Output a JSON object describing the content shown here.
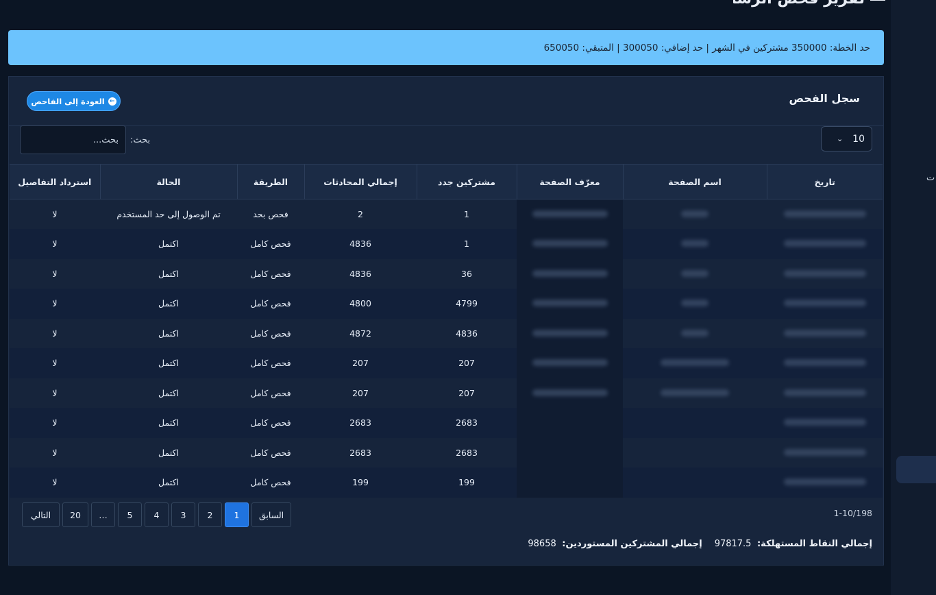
{
  "page": {
    "heading": "تقرير فحص الرسائل",
    "sidebar_stub": "ت"
  },
  "banner": {
    "text": "حد الخطة: 350000 مشتركين في الشهر | حد إضافي: 300050 | المتبقي: 650050"
  },
  "card": {
    "title": "سجل الفحص",
    "back_label": "العودة إلى الفاحص",
    "length_value": "10",
    "search_label": "بحث:",
    "search_placeholder": "بحث..."
  },
  "table": {
    "headers": [
      "تاريخ",
      "اسم الصفحة",
      "معرّف الصفحة",
      "مشتركين جدد",
      "إجمالي المحادثات",
      "الطريقة",
      "الحالة",
      "استرداد التفاصيل"
    ],
    "rows": [
      {
        "subscribers": "1",
        "conversations": "2",
        "method": "فحص بحد",
        "status": "تم الوصول إلى حد المستخدم",
        "refund": "لا"
      },
      {
        "subscribers": "1",
        "conversations": "4836",
        "method": "فحص كامل",
        "status": "اكتمل",
        "refund": "لا"
      },
      {
        "subscribers": "36",
        "conversations": "4836",
        "method": "فحص كامل",
        "status": "اكتمل",
        "refund": "لا"
      },
      {
        "subscribers": "4799",
        "conversations": "4800",
        "method": "فحص كامل",
        "status": "اكتمل",
        "refund": "لا"
      },
      {
        "subscribers": "4836",
        "conversations": "4872",
        "method": "فحص كامل",
        "status": "اكتمل",
        "refund": "لا"
      },
      {
        "subscribers": "207",
        "conversations": "207",
        "method": "فحص كامل",
        "status": "اكتمل",
        "refund": "لا"
      },
      {
        "subscribers": "207",
        "conversations": "207",
        "method": "فحص كامل",
        "status": "اكتمل",
        "refund": "لا"
      },
      {
        "subscribers": "2683",
        "conversations": "2683",
        "method": "فحص كامل",
        "status": "اكتمل",
        "refund": "لا"
      },
      {
        "subscribers": "2683",
        "conversations": "2683",
        "method": "فحص كامل",
        "status": "اكتمل",
        "refund": "لا"
      },
      {
        "subscribers": "199",
        "conversations": "199",
        "method": "فحص كامل",
        "status": "اكتمل",
        "refund": "لا"
      }
    ]
  },
  "footer": {
    "info": "1-10/198",
    "pagination": {
      "prev": "السابق",
      "pages": [
        "1",
        "2",
        "3",
        "4",
        "5",
        "…",
        "20"
      ],
      "next": "التالي",
      "active_page": "1"
    },
    "total_points_label": "إجمالي النقاط المستهلكة:",
    "total_points_value": "97817.5",
    "total_subscribers_label": "إجمالي المشتركين المستوردين:",
    "total_subscribers_value": "98658"
  },
  "colors": {
    "banner": "#6cc3fd",
    "accent": "#1e88e5",
    "background": "#0b1524"
  }
}
